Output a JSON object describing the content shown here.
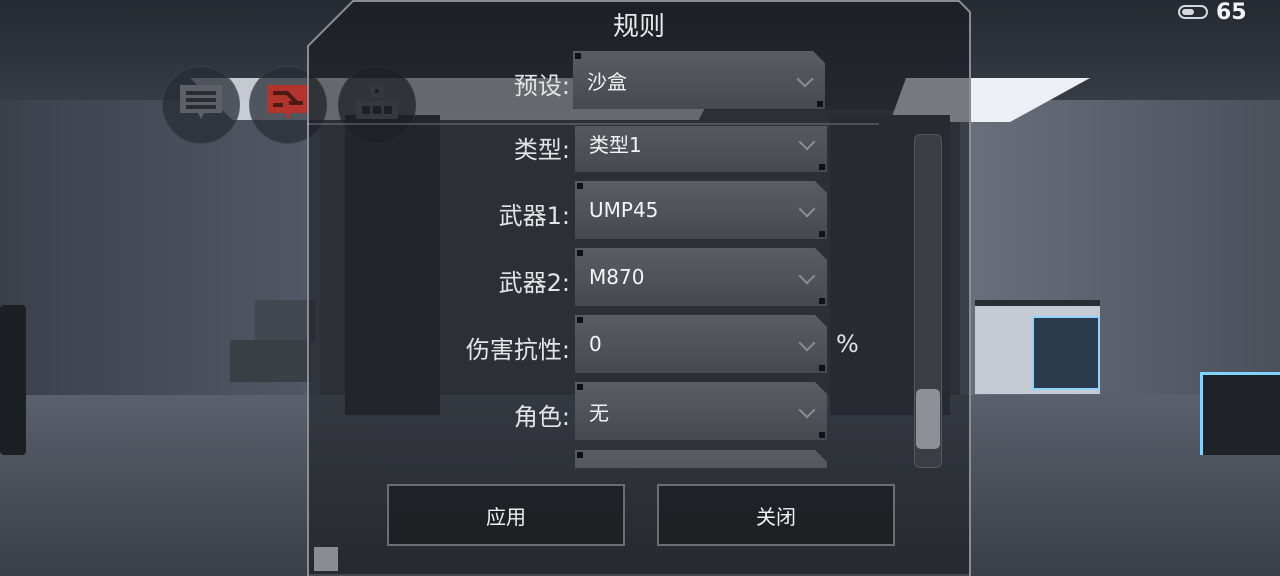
{
  "dialog": {
    "title": "规则",
    "preset": {
      "label": "预设:",
      "value": "沙盒"
    },
    "rows": [
      {
        "label": "类型:",
        "value": "类型1"
      },
      {
        "label": "武器1:",
        "value": "UMP45"
      },
      {
        "label": "武器2:",
        "value": "M870"
      },
      {
        "label": "伤害抗性:",
        "value": "0",
        "unit": "%"
      },
      {
        "label": "角色:",
        "value": "无"
      }
    ],
    "apply_label": "应用",
    "close_label": "关闭"
  },
  "hud": {
    "battery_value": "65",
    "battery_level": 0.55,
    "icons": [
      "chat-icon",
      "team-chat-icon",
      "network-icon"
    ],
    "active_icon_color": "#c0392b"
  }
}
